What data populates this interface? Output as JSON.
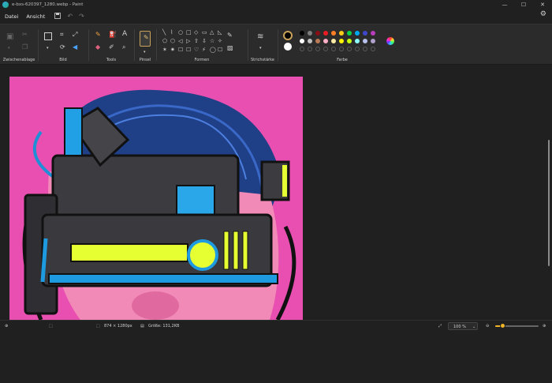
{
  "window": {
    "title": "e-bxs-620397_1280.webp - Paint",
    "minimize": "—",
    "maximize": "☐",
    "close": "✕"
  },
  "menu": {
    "file": "Datei",
    "view": "Ansicht"
  },
  "ribbon": {
    "groups": {
      "clipboard": "Zwischenablage",
      "image": "Bild",
      "tools": "Tools",
      "brushes": "Pinsel",
      "shapes": "Formen",
      "stroke": "Strichstärke",
      "colors": "Farbe"
    },
    "tools_text_glyph": "A",
    "shapes_row1": [
      "╲",
      "⌇",
      "○",
      "□",
      "◇",
      "▭",
      "△",
      "◺"
    ],
    "shapes_row2": [
      "⬠",
      "⬡",
      "◁",
      "▷",
      "⇧",
      "⇩",
      "☆",
      "✧"
    ],
    "shapes_row3": [
      "✶",
      "✷",
      "☐",
      "☐",
      "♡",
      "⚡",
      "◯",
      "☐"
    ],
    "palette_row1": [
      "#000000",
      "#7f7f7f",
      "#881015",
      "#ec1c24",
      "#ff7f27",
      "#ffca18",
      "#0ed145",
      "#00a8f3",
      "#3f48cc",
      "#b83dba"
    ],
    "palette_row2": [
      "#ffffff",
      "#c3c3c3",
      "#b97a56",
      "#ffaec8",
      "#fdeca6",
      "#fff200",
      "#c4ff0e",
      "#8cfffb",
      "#b8c1ec",
      "#b0a0cc"
    ],
    "primary_color": "#000000",
    "secondary_color": "#ffffff"
  },
  "status": {
    "dimensions": "874 × 1280px",
    "size": "Größe: 131,2KB",
    "zoom": "100 %",
    "zoom_fraction": 0.16
  }
}
